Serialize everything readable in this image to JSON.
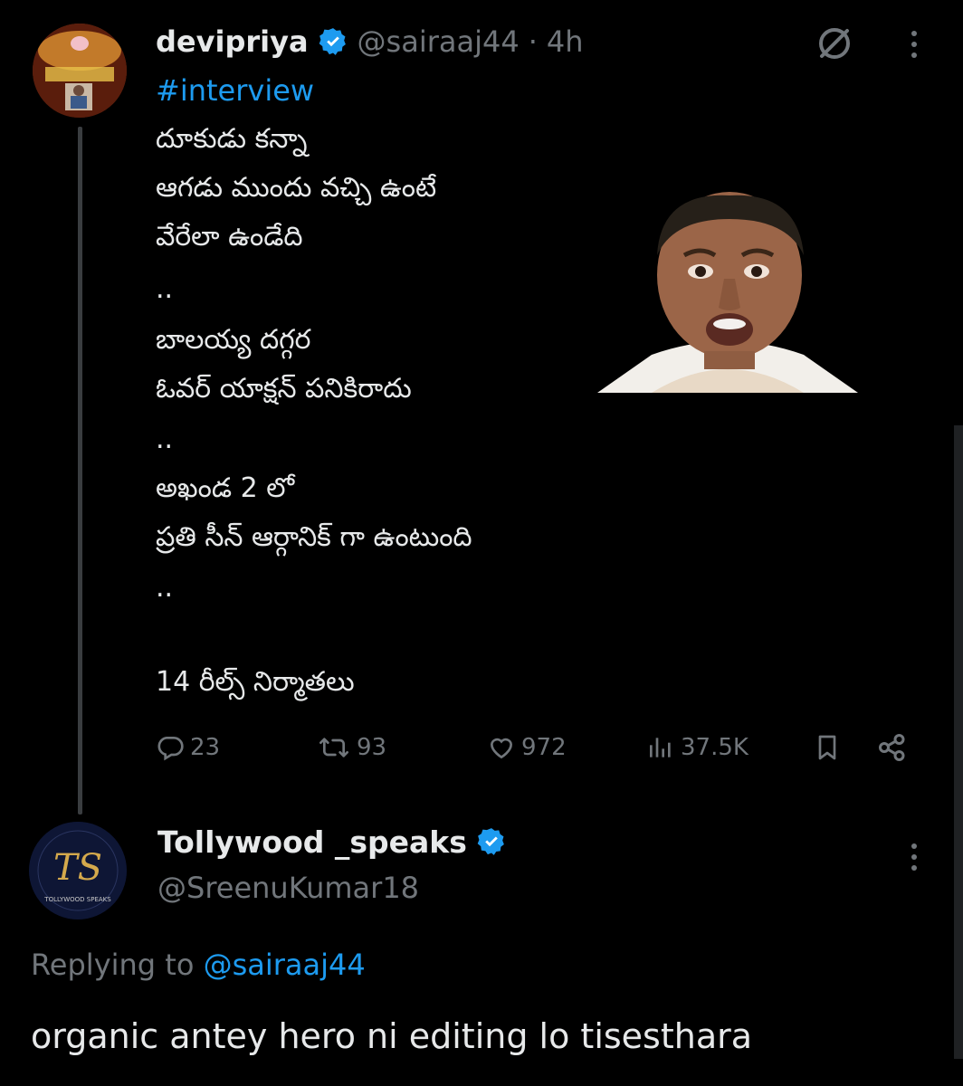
{
  "tweet": {
    "author_name": "devipriya",
    "handle": "@sairaaj44",
    "separator": "·",
    "time": "4h",
    "hashtag": "#interview",
    "lines": [
      "దూకుడు కన్నా",
      "ఆగడు ముందు వచ్చి ఉంటే",
      "వేరేలా ఉండేది",
      "..",
      "బాలయ్య దగ్గర",
      "ఓవర్ యాక్షన్ పనికిరాదు",
      "..",
      "అఖండ 2 లో",
      "ప్రతి సీన్ ఆర్గానిక్ గా ఉంటుంది",
      "..",
      "",
      "14 రీల్స్ నిర్మాతలు"
    ],
    "stats": {
      "replies": "23",
      "reposts": "93",
      "likes": "972",
      "views": "37.5K"
    }
  },
  "reply": {
    "author_name": "Tollywood _speaks",
    "handle": "@SreenuKumar18",
    "replying_prefix": "Replying to",
    "replying_handle": "@sairaaj44",
    "text": "organic antey hero ni editing lo tisesthara",
    "avatar_logo": "TS",
    "avatar_ring_text": "TOLLYWOOD SPEAKS"
  },
  "icons": {
    "verified": "verified-badge-icon",
    "grok": "grok-slash-icon",
    "more": "more-vertical-icon",
    "reply": "reply-bubble-icon",
    "repost": "repost-icon",
    "like": "heart-icon",
    "views": "analytics-bars-icon",
    "bookmark": "bookmark-icon",
    "share": "share-icon"
  },
  "colors": {
    "background": "#000000",
    "accent": "#1d9bf0",
    "muted": "#71767b",
    "text": "#e7e9ea"
  }
}
